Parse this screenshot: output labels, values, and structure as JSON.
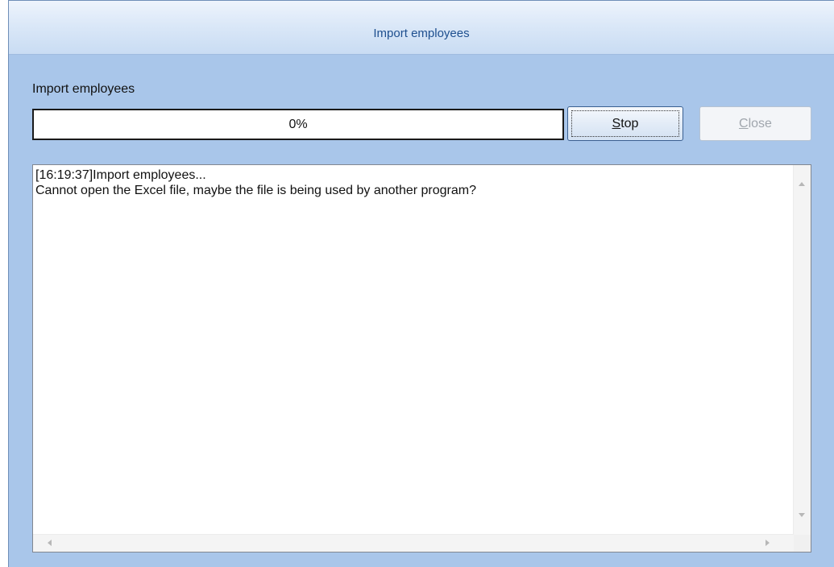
{
  "window": {
    "title": "Import employees"
  },
  "main": {
    "section_label": "Import employees",
    "progress": {
      "percent": 0,
      "text": "0%"
    },
    "buttons": {
      "stop": {
        "mnemonic": "S",
        "rest": "top",
        "enabled": true
      },
      "close": {
        "mnemonic": "C",
        "rest": "lose",
        "enabled": false
      }
    },
    "log": {
      "lines": [
        "[16:19:37]Import employees...",
        "Cannot open the Excel file, maybe the file is being used by another program?"
      ]
    }
  },
  "icons": {
    "scroll_up": "chevron-up-icon",
    "scroll_down": "chevron-down-icon",
    "scroll_left": "chevron-left-icon",
    "scroll_right": "chevron-right-icon"
  },
  "colors": {
    "window_background": "#a9c6ea",
    "title_text": "#1e4f8f",
    "progress_fill": "#3d82d8"
  }
}
